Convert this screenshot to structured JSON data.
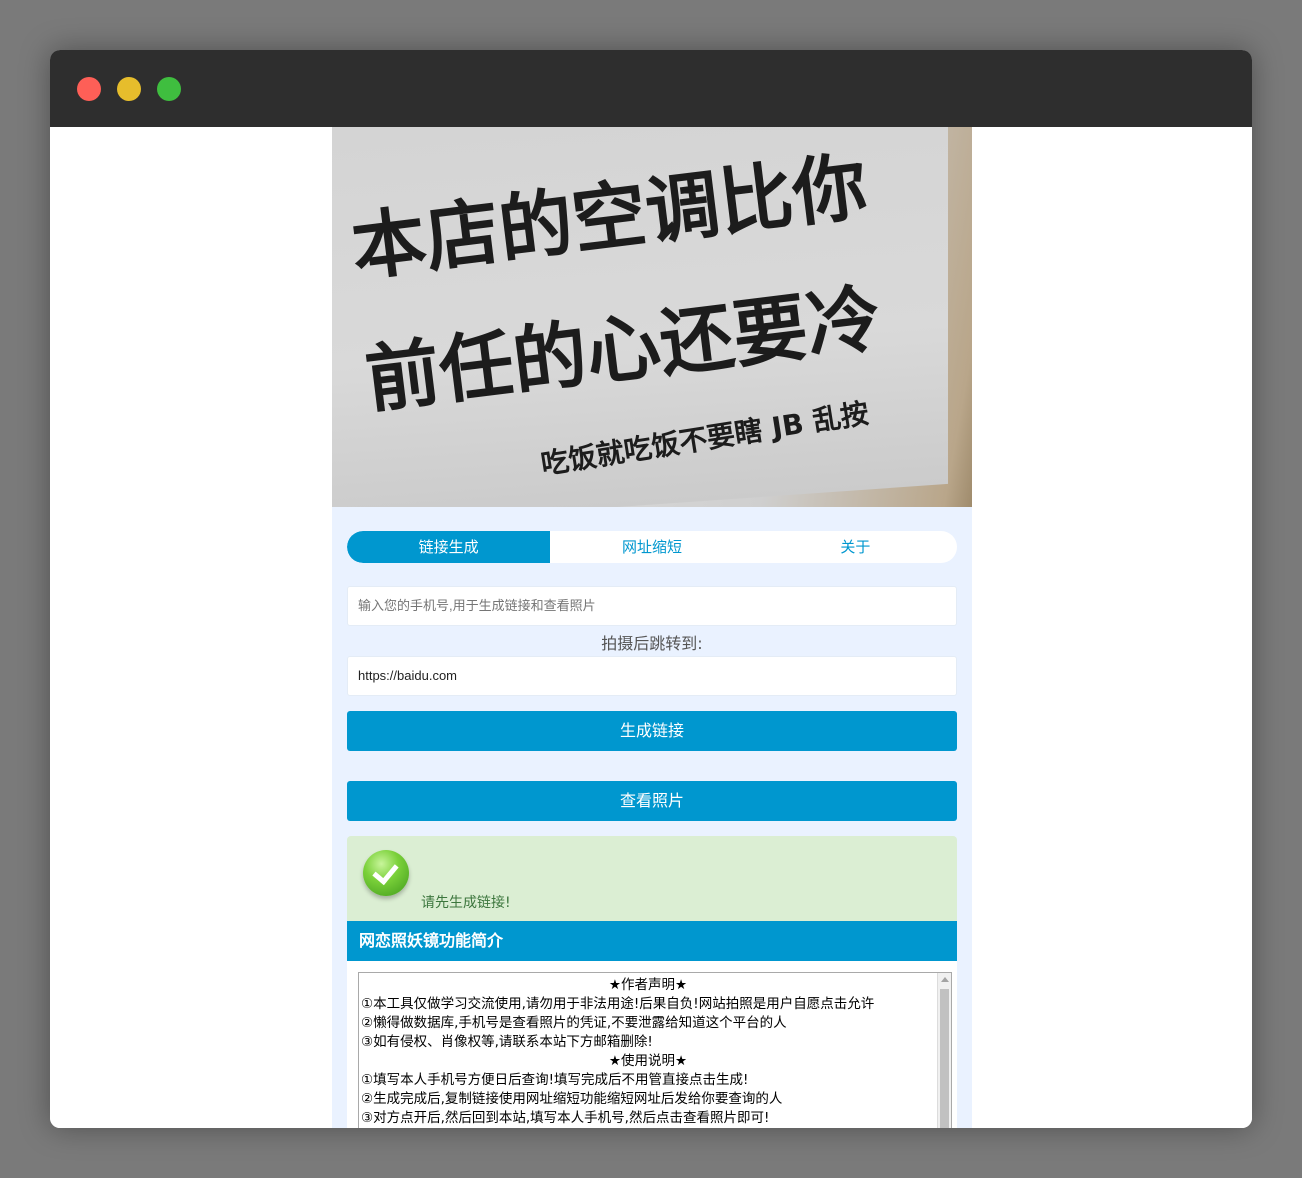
{
  "hero": {
    "line1": "本店的空调比你",
    "line2": "前任的心还要冷",
    "line3": "吃饭就吃饭不要瞎 JB 乱按"
  },
  "tabs": [
    {
      "label": "链接生成",
      "active": true
    },
    {
      "label": "网址缩短",
      "active": false
    },
    {
      "label": "关于",
      "active": false
    }
  ],
  "form": {
    "phone_placeholder": "输入您的手机号,用于生成链接和查看照片",
    "redirect_label": "拍摄后跳转到:",
    "redirect_value": "https://baidu.com",
    "generate_label": "生成链接",
    "view_label": "查看照片"
  },
  "status": {
    "message": "请先生成链接!"
  },
  "panel": {
    "title": "网恋照妖镜功能简介",
    "author_heading": "★作者声明★",
    "author_lines": [
      "①本工具仅做学习交流使用,请勿用于非法用途!后果自负!网站拍照是用户自愿点击允许",
      "②懒得做数据库,手机号是查看照片的凭证,不要泄露给知道这个平台的人",
      "③如有侵权、肖像权等,请联系本站下方邮箱删除!"
    ],
    "usage_heading": "★使用说明★",
    "usage_lines": [
      "①填写本人手机号方便日后查询!填写完成后不用管直接点击生成!",
      "②生成完成后,复制链接使用网址缩短功能缩短网址后发给你要查询的人",
      "③对方点开后,然后回到本站,填写本人手机号,然后点击查看照片即可!"
    ]
  },
  "colors": {
    "accent": "#0097cf",
    "success_bg": "#dbeed3",
    "success_text": "#3c763d"
  }
}
